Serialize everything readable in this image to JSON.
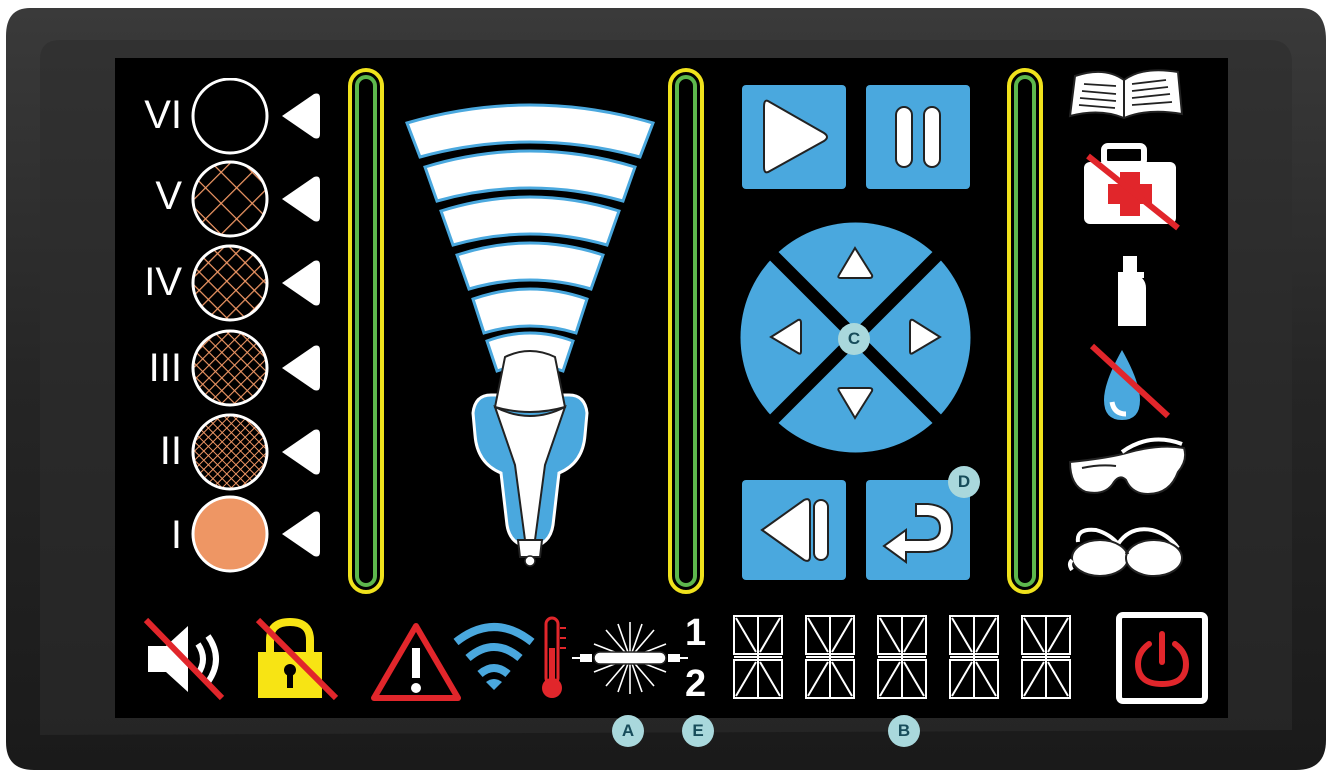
{
  "colors": {
    "screen_bg": "#000000",
    "accent_blue": "#4aa8de",
    "bar_yellow": "#f0e21c",
    "bar_green": "#5db84c",
    "skin_orange": "#ee9664",
    "warning_red": "#e1262b",
    "lock_yellow": "#f7e414",
    "marker_teal": "#a9d8dc"
  },
  "skin_types": [
    {
      "label": "VI",
      "fill": "empty"
    },
    {
      "label": "V",
      "fill": "sparse-hatch"
    },
    {
      "label": "IV",
      "fill": "hatch"
    },
    {
      "label": "III",
      "fill": "dense-hatch"
    },
    {
      "label": "II",
      "fill": "very-dense-hatch"
    },
    {
      "label": "I",
      "fill": "solid"
    }
  ],
  "level_bars": [
    {
      "name": "bar-left"
    },
    {
      "name": "bar-middle"
    },
    {
      "name": "bar-right"
    }
  ],
  "applicator": {
    "arcs": 6
  },
  "controls": {
    "play_icon": "play-icon",
    "pause_icon": "pause-icon",
    "dpad_center_marker": "C",
    "back_icon": "step-back-icon",
    "return_icon": "return-arrow-icon",
    "return_marker": "D"
  },
  "right_icons": [
    "manual-book-icon",
    "first-aid-kit-crossed-icon",
    "bottle-icon",
    "water-drop-crossed-icon",
    "safety-glasses-icon",
    "goggles-icon"
  ],
  "status_bar": {
    "icons": [
      "speaker-muted-crossed-icon",
      "padlock-crossed-icon",
      "warning-triangle-icon",
      "wifi-icon",
      "thermometer-icon",
      "flash-lamp-icon"
    ],
    "lamp_numbers": [
      "1",
      "2"
    ],
    "segment_digits": 5,
    "power_icon": "power-icon"
  },
  "markers": {
    "lamp": "A",
    "lamp_numbers": "E",
    "display": "B"
  }
}
